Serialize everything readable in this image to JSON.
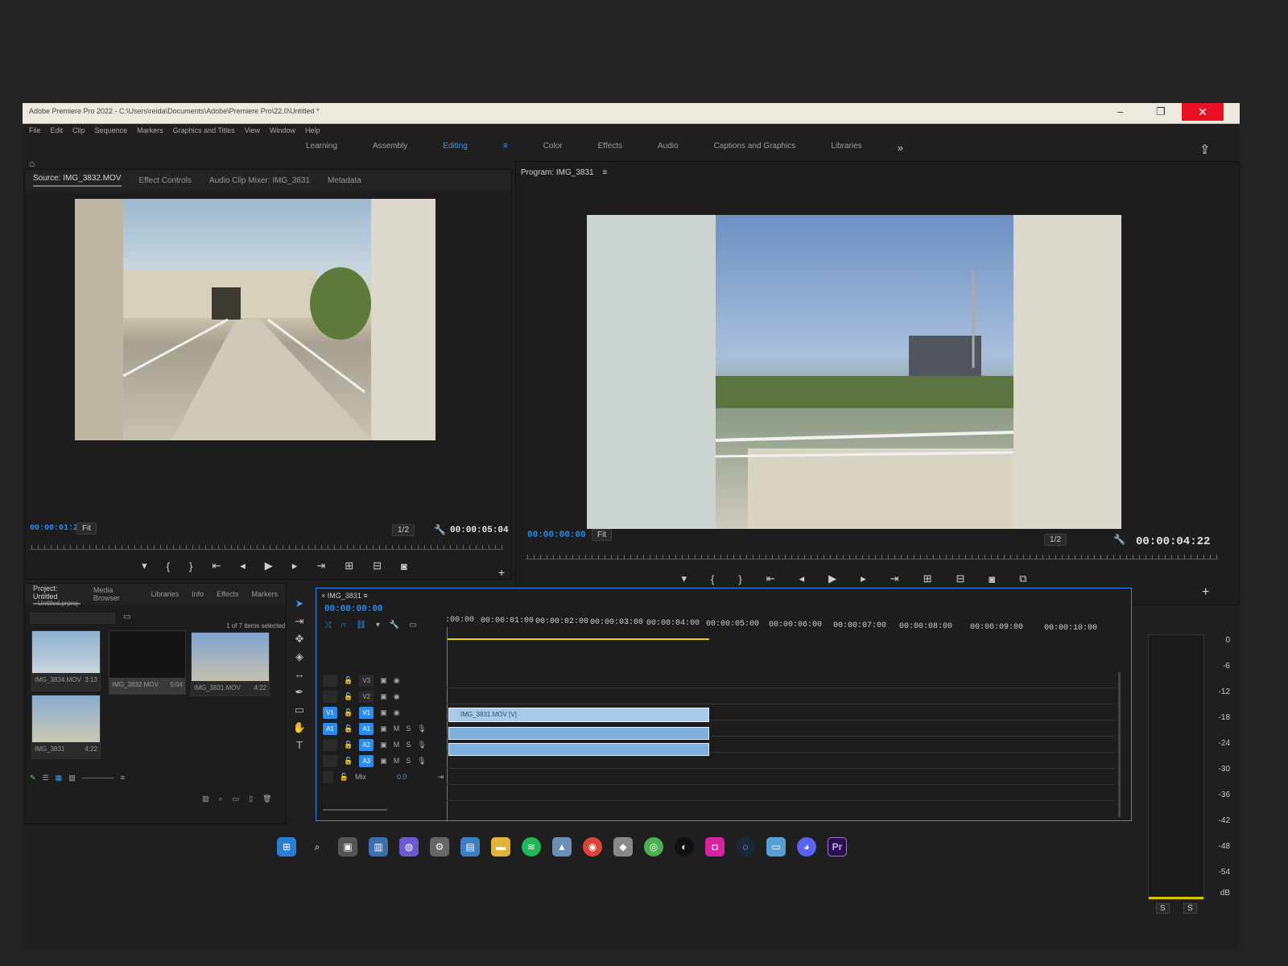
{
  "window": {
    "title": "Adobe Premiere Pro 2022 - C:\\Users\\reida\\Documents\\Adobe\\Premiere Pro\\22.0\\Untitled *",
    "controls": {
      "minimize": "–",
      "maximize": "❐",
      "close": "✕"
    }
  },
  "menu": [
    "File",
    "Edit",
    "Clip",
    "Sequence",
    "Markers",
    "Graphics and Titles",
    "View",
    "Window",
    "Help"
  ],
  "workspaces": {
    "items": [
      "Learning",
      "Assembly",
      "Editing",
      "Color",
      "Effects",
      "Audio",
      "Captions and Graphics",
      "Libraries"
    ],
    "active": "Editing",
    "overflow": "»"
  },
  "source_panel": {
    "tabs": [
      "Source: IMG_3832.MOV",
      "Effect Controls",
      "Audio Clip Mixer: IMG_3831",
      "Metadata"
    ],
    "timecode_in": "00:00:01:21",
    "fit": "Fit",
    "resolution": "1/2",
    "duration": "00:00:05:04"
  },
  "program_panel": {
    "title": "Program: IMG_3831",
    "timecode_in": "00:00:00:00",
    "fit": "Fit",
    "resolution": "1/2",
    "duration": "00:00:04:22"
  },
  "project_panel": {
    "tabs": [
      "Project: Untitled",
      "Media Browser",
      "Libraries",
      "Info",
      "Effects",
      "Markers"
    ],
    "project_file": "Untitled.prproj",
    "search_placeholder": "",
    "selection_info": "1 of 7 items selected",
    "items": [
      {
        "name": "IMG_3834.MOV",
        "duration": "3:13"
      },
      {
        "name": "IMG_3832.MOV",
        "duration": "5:04"
      },
      {
        "name": "IMG_3831.MOV",
        "duration": "4:22"
      },
      {
        "name": "IMG_3831",
        "duration": "4:22"
      }
    ]
  },
  "timeline": {
    "sequence": "IMG_3831",
    "timecode": "00:00:00:00",
    "ruler": [
      ":00:00",
      "00:00:01:00",
      "00:00:02:00",
      "00:00:03:00",
      "00:00:04:00",
      "00:00:05:00",
      "00:00:06:00",
      "00:00:07:00",
      "00:00:08:00",
      "00:00:09:00",
      "00:00:10:00"
    ],
    "video_tracks": [
      "V3",
      "V2",
      "V1"
    ],
    "audio_tracks": [
      "A1",
      "A2",
      "A3"
    ],
    "mix_label": "Mix",
    "mix_value": "0.0",
    "clip_label": "IMG_3831.MOV [V]",
    "clip_fraction": 0.47
  },
  "audio_meter": {
    "scale": [
      "0",
      "-6",
      "-12",
      "-18",
      "-24",
      "-30",
      "-36",
      "-42",
      "-48",
      "-54",
      "dB"
    ],
    "solo": [
      "S",
      "S"
    ]
  },
  "taskbar": {
    "icons": [
      "windows-icon",
      "search-icon",
      "taskview-icon",
      "widgets-icon",
      "chat-icon",
      "settings-icon",
      "notepad-icon",
      "explorer-icon",
      "spotify-icon",
      "photos-icon",
      "chrome-icon",
      "app-icon",
      "app-icon-2",
      "github-icon",
      "instagram-icon",
      "steam-icon",
      "monitor-icon",
      "discord-icon",
      "premiere-icon"
    ],
    "premiere_label": "Pr"
  },
  "colors": {
    "accent": "#2d8ceb",
    "titlebar": "#ece9df",
    "close": "#e81123",
    "panel": "#1d1d1d"
  }
}
